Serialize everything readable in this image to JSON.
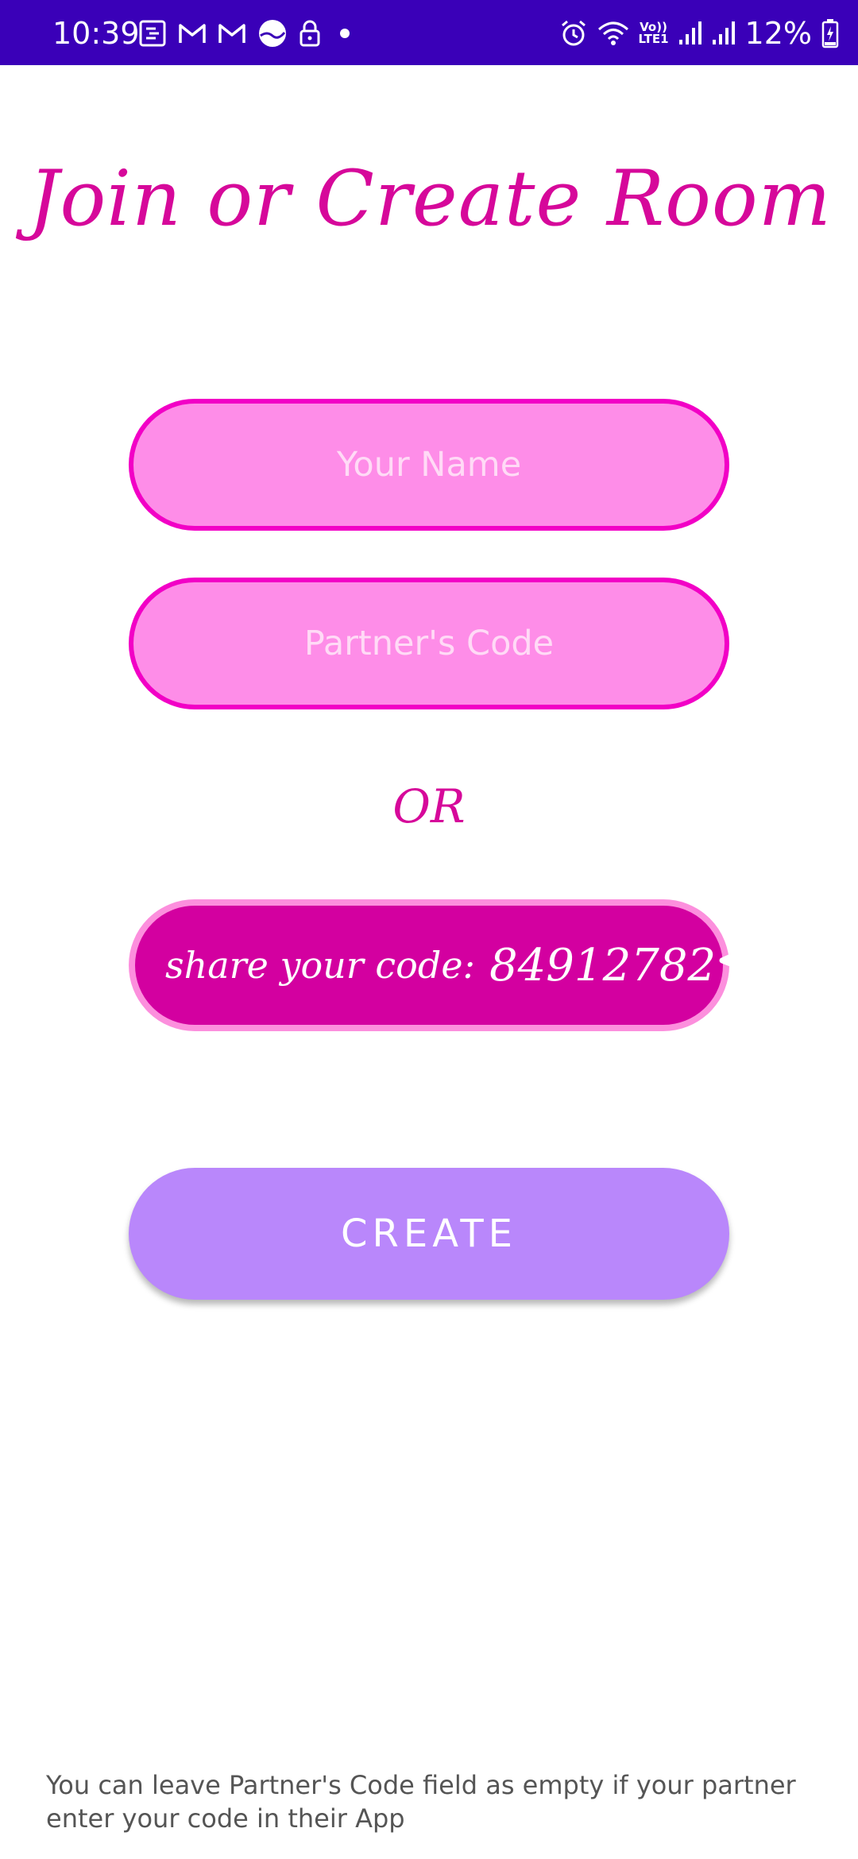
{
  "status_bar": {
    "time": "10:39",
    "left_icons": [
      "focus-mode-icon",
      "gmail-icon",
      "gmail-icon",
      "pie-app-icon",
      "lock-icon",
      "dot-icon"
    ],
    "right_icons": [
      "alarm-icon",
      "wifi-icon",
      "volte-icon",
      "signal-icon",
      "signal-icon",
      "battery-charging-icon"
    ],
    "volte_label_top": "Vo))",
    "volte_label_bottom": "LTE1",
    "battery": "12%",
    "background_color": "#3a00b8"
  },
  "page": {
    "title": "Join or Create Room"
  },
  "form": {
    "name_placeholder": "Your Name",
    "name_value": "",
    "partner_code_placeholder": "Partner's Code",
    "partner_code_value": ""
  },
  "separator": {
    "text": "OR"
  },
  "share": {
    "label": "share your code:",
    "code": "84912782",
    "icon": "send-icon"
  },
  "actions": {
    "create_label": "CREATE"
  },
  "footer": {
    "note": "You can leave Partner's Code field as empty if your partner enter your code in their App"
  },
  "colors": {
    "accent_pink": "#d6089a",
    "input_fill": "#fe8de8",
    "input_border": "#f200c6",
    "share_fill": "#d300a0",
    "share_border": "#fc8fdd",
    "create_fill": "#b987fb"
  }
}
